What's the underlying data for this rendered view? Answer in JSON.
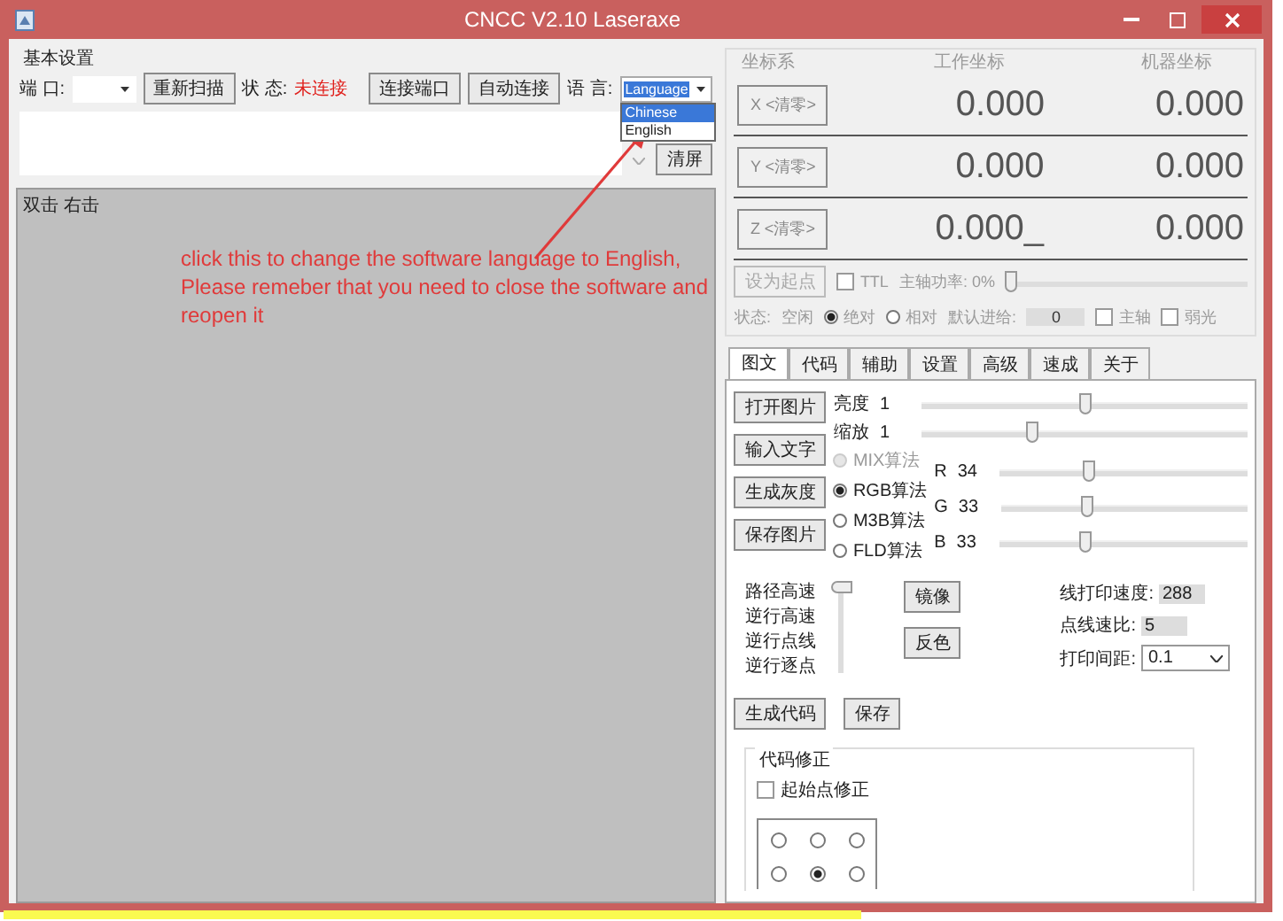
{
  "window": {
    "title": "CNCC V2.10  Laseraxe"
  },
  "basic_settings": {
    "title": "基本设置",
    "port_label": "端 口:",
    "rescan_button": "重新扫描",
    "status_label": "状 态:",
    "status_value": "未连接",
    "connect_button": "连接端口",
    "auto_connect_button": "自动连接",
    "language_label": "语 言:",
    "language_value": "Language",
    "language_options": [
      {
        "label": "Chinese",
        "selected": true
      },
      {
        "label": "English",
        "selected": false
      }
    ],
    "clear_button": "清屏"
  },
  "canvas": {
    "hint": "双击 右击"
  },
  "annotation": {
    "text": "click this to change the software language to English,\nPlease remeber that you need to close the software and\nreopen it"
  },
  "coordinates": {
    "title": "坐标系",
    "work_label": "工作坐标",
    "machine_label": "机器坐标",
    "axes": [
      {
        "button": "X <清零>",
        "work": "0.000",
        "machine": "0.000"
      },
      {
        "button": "Y <清零>",
        "work": "0.000",
        "machine": "0.000"
      },
      {
        "button": "Z <清零>",
        "work": "0.000_",
        "machine": "0.000"
      }
    ],
    "set_origin_button": "设为起点",
    "ttl": {
      "label": "TTL",
      "checked": false
    },
    "spindle_power_label": "主轴功率: 0%",
    "spindle_power": {
      "level": 0
    },
    "state_label": "状态:",
    "state_value": "空闲",
    "modes": [
      {
        "label": "绝对",
        "selected": true
      },
      {
        "label": "相对",
        "selected": false
      }
    ],
    "feed_label": "默认进给:",
    "feed_value": "0",
    "toggles": [
      {
        "label": "主轴",
        "checked": false
      },
      {
        "label": "弱光",
        "checked": false
      }
    ]
  },
  "tabs": [
    {
      "label": "图文",
      "selected": true
    },
    {
      "label": "代码",
      "selected": false
    },
    {
      "label": "辅助",
      "selected": false
    },
    {
      "label": "设置",
      "selected": false
    },
    {
      "label": "高级",
      "selected": false
    },
    {
      "label": "速成",
      "selected": false
    },
    {
      "label": "关于",
      "selected": false
    }
  ],
  "image_panel": {
    "buttons": [
      "打开图片",
      "输入文字",
      "生成灰度",
      "保存图片"
    ],
    "sliders": [
      {
        "label": "亮度",
        "value": "1",
        "level": 0.5
      },
      {
        "label": "缩放",
        "value": "1",
        "level": 0.33
      }
    ],
    "algorithms": [
      {
        "label": "MIX算法",
        "selected": false,
        "disabled": true
      },
      {
        "label": "RGB算法",
        "selected": true,
        "disabled": false
      },
      {
        "label": "M3B算法",
        "selected": false,
        "disabled": false
      },
      {
        "label": "FLD算法",
        "selected": false,
        "disabled": false
      }
    ],
    "channels": [
      {
        "label": "R",
        "value": "34",
        "level": 0.35
      },
      {
        "label": "G",
        "value": "33",
        "level": 0.34
      },
      {
        "label": "B",
        "value": "33",
        "level": 0.34
      }
    ],
    "speed_labels": [
      "路径高速",
      "逆行高速",
      "逆行点线",
      "逆行逐点"
    ],
    "speed_slider": {
      "level": 1
    },
    "mirror_button": "镜像",
    "invert_button": "反色",
    "line_speed_label": "线打印速度:",
    "line_speed_value": "288",
    "ratio_label": "点线速比:",
    "ratio_value": "5",
    "spacing_label": "打印间距:",
    "spacing_value": "0.1",
    "generate_button": "生成代码",
    "save_button": "保存",
    "correction": {
      "title": "代码修正",
      "start_point": {
        "label": "起始点修正",
        "checked": false
      },
      "points": [
        {
          "selected": false
        },
        {
          "selected": false
        },
        {
          "selected": false
        },
        {
          "selected": false
        },
        {
          "selected": true
        },
        {
          "selected": false
        }
      ]
    }
  }
}
